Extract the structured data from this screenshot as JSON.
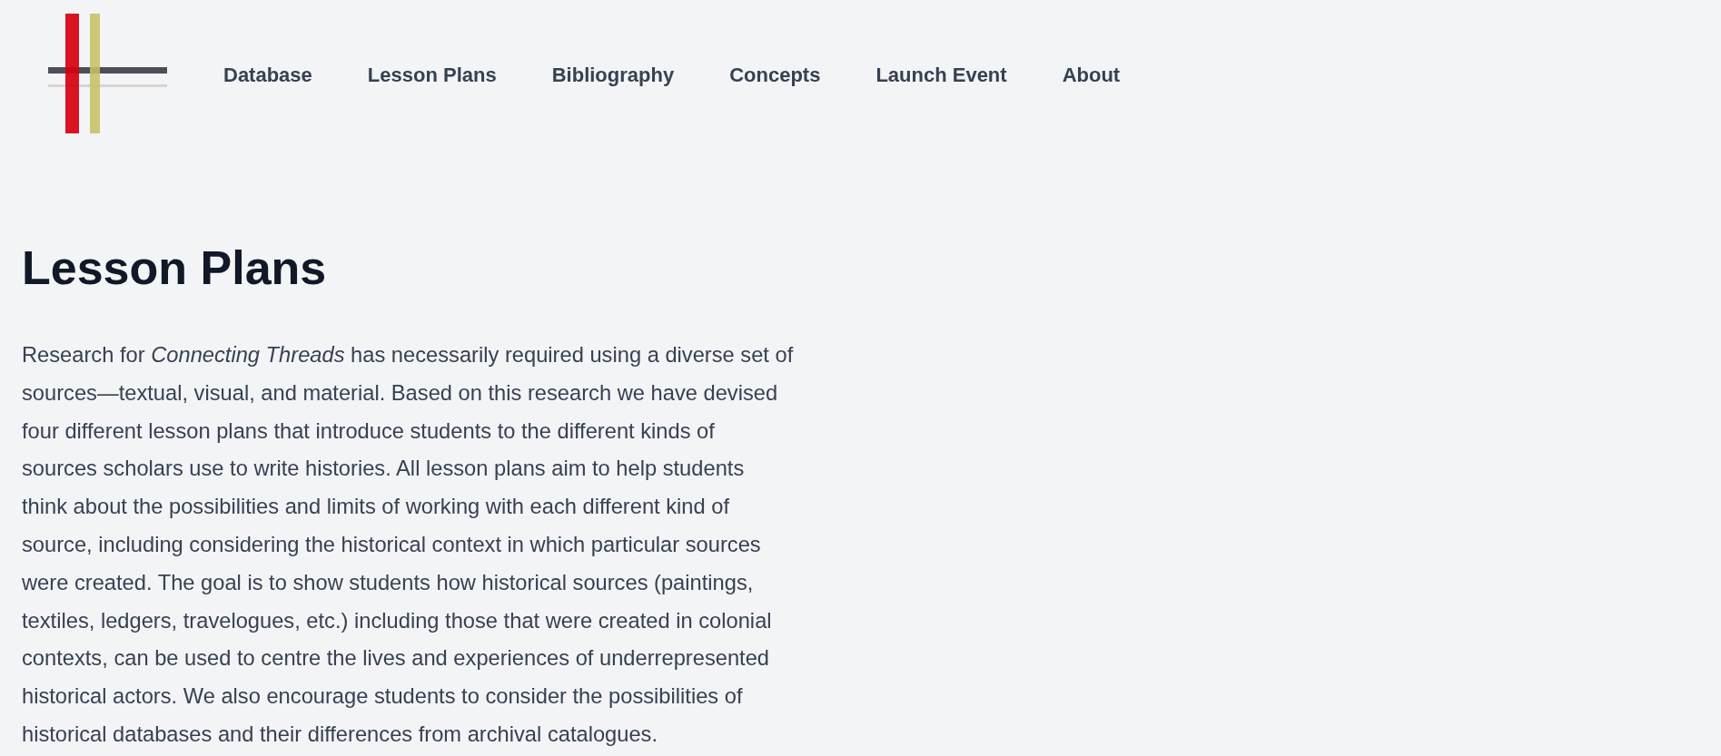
{
  "nav": {
    "links": [
      "Database",
      "Lesson Plans",
      "Bibliography",
      "Concepts",
      "Launch Event",
      "About"
    ]
  },
  "page": {
    "title": "Lesson Plans",
    "intro": "Research for *Connecting Threads* has necessarily required using a diverse set of sources—textual, visual, and material. Based on this research we have devised four different lesson plans that introduce students to the different kinds of sources scholars use to write histories. All lesson plans aim to help students think about the possibilities and limits of working with each different kind of source, including considering the historical context in which particular sources were created. The goal is to show students how historical sources (paintings, textiles, ledgers, travelogues, etc.) including those that were created in colonial contexts, can be used to centre the lives and experiences of underrepresented historical actors. We also encourage students to consider the possibilities of historical databases and their differences from archival catalogues."
  }
}
